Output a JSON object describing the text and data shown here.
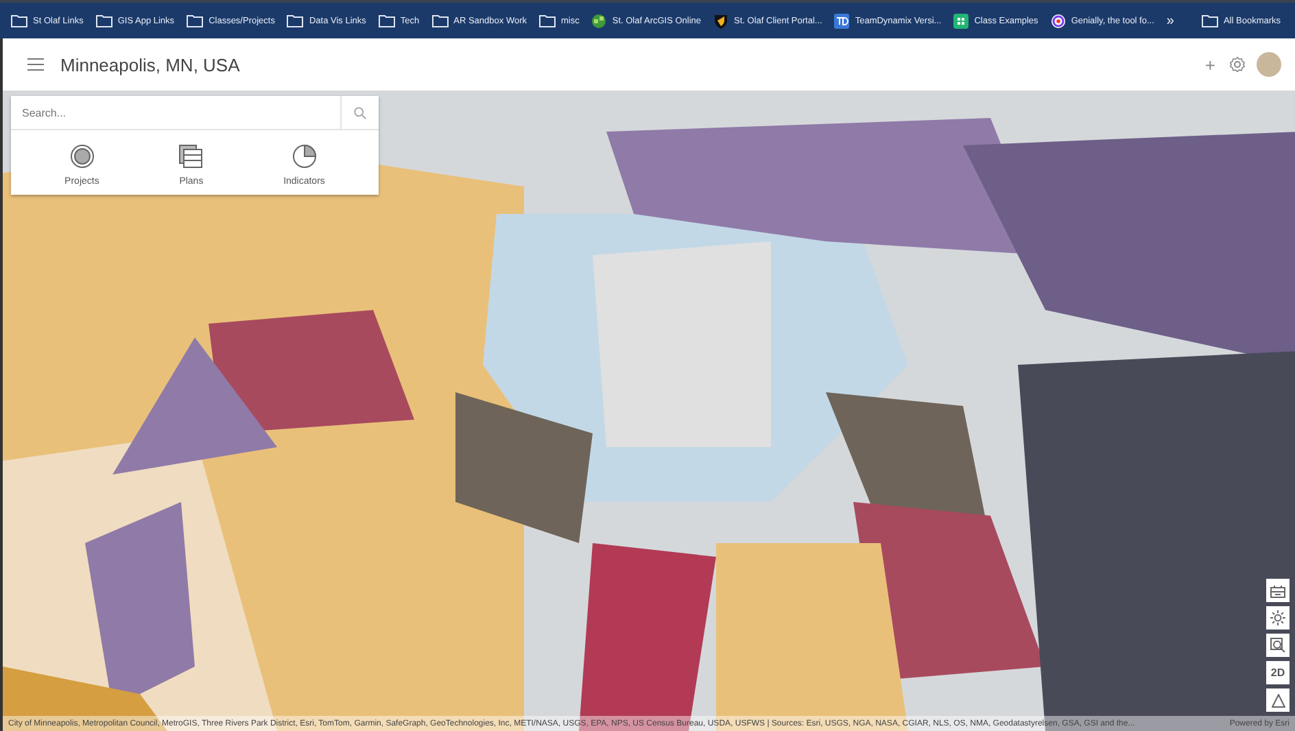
{
  "bookmarks": [
    {
      "kind": "folder",
      "label": "St Olaf Links"
    },
    {
      "kind": "folder",
      "label": "GIS App Links"
    },
    {
      "kind": "folder",
      "label": "Classes/Projects"
    },
    {
      "kind": "folder",
      "label": "Data Vis Links"
    },
    {
      "kind": "folder",
      "label": "Tech"
    },
    {
      "kind": "folder",
      "label": "AR Sandbox Work"
    },
    {
      "kind": "folder",
      "label": "misc"
    },
    {
      "kind": "globe",
      "label": "St. Olaf ArcGIS Online"
    },
    {
      "kind": "shield",
      "label": "St. Olaf Client Portal..."
    },
    {
      "kind": "td",
      "label": "TeamDynamix Versi..."
    },
    {
      "kind": "grid",
      "label": "Class Examples"
    },
    {
      "kind": "swirl",
      "label": "Genially, the tool fo..."
    }
  ],
  "bookmarks_more": "»",
  "all_bookmarks": {
    "kind": "folder",
    "label": "All Bookmarks"
  },
  "header": {
    "title": "Minneapolis, MN, USA",
    "add": "+"
  },
  "search": {
    "placeholder": "Search..."
  },
  "panel_items": [
    {
      "kind": "projects",
      "label": "Projects"
    },
    {
      "kind": "plans",
      "label": "Plans"
    },
    {
      "kind": "indicators",
      "label": "Indicators"
    }
  ],
  "map_controls": [
    {
      "kind": "daylight-grid"
    },
    {
      "kind": "sun"
    },
    {
      "kind": "zoom-area"
    },
    {
      "kind": "text",
      "label": "2D"
    },
    {
      "kind": "compass"
    }
  ],
  "attribution": "City of Minneapolis, Metropolitan Council, MetroGIS, Three Rivers Park District, Esri, TomTom, Garmin, SafeGraph, GeoTechnologies, Inc, METI/NASA, USGS, EPA, NPS, US Census Bureau, USDA, USFWS | Sources: Esri, USGS, NGA, NASA, CGIAR, NLS, OS, NMA, Geodatastyrelsen, GSA, GSI and the...",
  "powered_by": "Powered by Esri"
}
